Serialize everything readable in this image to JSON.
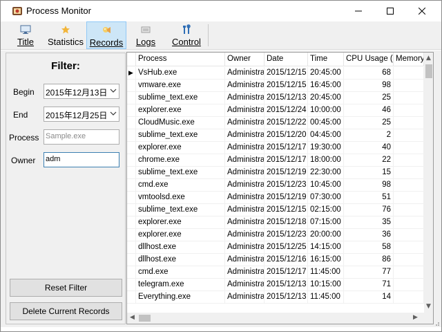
{
  "window": {
    "title": "Process Monitor"
  },
  "toolbar": {
    "title_label": "Title",
    "statistics_label": "Statistics",
    "records_label": "Records",
    "logs_label": "Logs",
    "control_label": "Control",
    "active_tab": "Records",
    "colors": {
      "active_bg": "#cde6f7",
      "active_border": "#90c8f6"
    }
  },
  "filter": {
    "heading": "Filter:",
    "begin_label": "Begin",
    "begin_value": "2015年12月13日",
    "end_label": "End",
    "end_value": "2015年12月25日",
    "process_label": "Process",
    "process_value": "Sample.exe",
    "owner_label": "Owner",
    "owner_value": "adm",
    "reset_button": "Reset Filter",
    "delete_button": "Delete Current Records"
  },
  "table": {
    "columns": [
      "Process",
      "Owner",
      "Date",
      "Time",
      "CPU Usage (s)",
      "Memory"
    ],
    "rows": [
      [
        "VsHub.exe",
        "Administrat",
        "2015/12/15",
        "20:45:00",
        "68"
      ],
      [
        "vmware.exe",
        "Administrat",
        "2015/12/15",
        "16:45:00",
        "98"
      ],
      [
        "sublime_text.exe",
        "Administrat",
        "2015/12/13",
        "20:45:00",
        "25"
      ],
      [
        "explorer.exe",
        "Administrat",
        "2015/12/24",
        "10:00:00",
        "46"
      ],
      [
        "CloudMusic.exe",
        "Administrat",
        "2015/12/22",
        "00:45:00",
        "25"
      ],
      [
        "sublime_text.exe",
        "Administrat",
        "2015/12/20",
        "04:45:00",
        "2"
      ],
      [
        "explorer.exe",
        "Administrat",
        "2015/12/17",
        "19:30:00",
        "40"
      ],
      [
        "chrome.exe",
        "Administrat",
        "2015/12/17",
        "18:00:00",
        "22"
      ],
      [
        "sublime_text.exe",
        "Administrat",
        "2015/12/19",
        "22:30:00",
        "15"
      ],
      [
        "cmd.exe",
        "Administrat",
        "2015/12/23",
        "10:45:00",
        "98"
      ],
      [
        "vmtoolsd.exe",
        "Administrat",
        "2015/12/19",
        "07:30:00",
        "51"
      ],
      [
        "sublime_text.exe",
        "Administrat",
        "2015/12/15",
        "02:15:00",
        "76"
      ],
      [
        "explorer.exe",
        "Administrat",
        "2015/12/18",
        "07:15:00",
        "35"
      ],
      [
        "explorer.exe",
        "Administrat",
        "2015/12/23",
        "20:00:00",
        "36"
      ],
      [
        "dllhost.exe",
        "Administrat",
        "2015/12/25",
        "14:15:00",
        "58"
      ],
      [
        "dllhost.exe",
        "Administrat",
        "2015/12/16",
        "16:15:00",
        "86"
      ],
      [
        "cmd.exe",
        "Administrat",
        "2015/12/17",
        "11:45:00",
        "77"
      ],
      [
        "telegram.exe",
        "Administrat",
        "2015/12/13",
        "10:15:00",
        "71"
      ],
      [
        "Everything.exe",
        "Administrat",
        "2015/12/13",
        "11:45:00",
        "14"
      ]
    ],
    "current_row_marker": "▶"
  }
}
